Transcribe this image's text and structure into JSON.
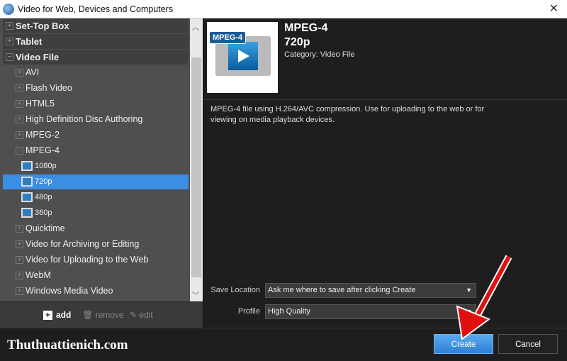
{
  "window": {
    "title": "Video for Web, Devices and Computers"
  },
  "tree": {
    "items": [
      {
        "label": "Set-Top Box",
        "level": 0,
        "type": "category",
        "expanded": false
      },
      {
        "label": "Tablet",
        "level": 0,
        "type": "category",
        "expanded": false
      },
      {
        "label": "Video File",
        "level": 0,
        "type": "category",
        "expanded": true
      },
      {
        "label": "AVI",
        "level": 1,
        "expanded": false
      },
      {
        "label": "Flash Video",
        "level": 1,
        "expanded": false
      },
      {
        "label": "HTML5",
        "level": 1,
        "expanded": false
      },
      {
        "label": "High Definition Disc Authoring",
        "level": 1,
        "expanded": false
      },
      {
        "label": "MPEG-2",
        "level": 1,
        "expanded": false
      },
      {
        "label": "MPEG-4",
        "level": 1,
        "expanded": true
      },
      {
        "label": "1080p",
        "level": 2
      },
      {
        "label": "720p",
        "level": 2,
        "selected": true
      },
      {
        "label": "480p",
        "level": 2
      },
      {
        "label": "360p",
        "level": 2
      },
      {
        "label": "Quicktime",
        "level": 1,
        "expanded": false
      },
      {
        "label": "Video for Archiving or Editing",
        "level": 1,
        "expanded": false
      },
      {
        "label": "Video for Uploading to the Web",
        "level": 1,
        "expanded": false
      },
      {
        "label": "WebM",
        "level": 1,
        "expanded": false
      },
      {
        "label": "Windows Media Video",
        "level": 1,
        "expanded": false
      }
    ]
  },
  "toolbar": {
    "add": "add",
    "remove": "remove",
    "edit": "edit"
  },
  "preset": {
    "icon_label": "MPEG-4",
    "format": "MPEG-4",
    "name": "720p",
    "category": "Category: Video File",
    "description": "MPEG-4 file using H.264/AVC compression. Use for uploading to the web or for viewing on media playback devices."
  },
  "form": {
    "save_location_label": "Save Location",
    "save_location_value": "Ask me where to save after clicking Create",
    "profile_label": "Profile",
    "profile_value": "High Quality"
  },
  "buttons": {
    "create": "Create",
    "cancel": "Cancel"
  },
  "watermark": "Thuthuattienich.com",
  "colors": {
    "selection": "#3b8fe3",
    "create": "#3f90e0",
    "arrow": "#e01010"
  }
}
